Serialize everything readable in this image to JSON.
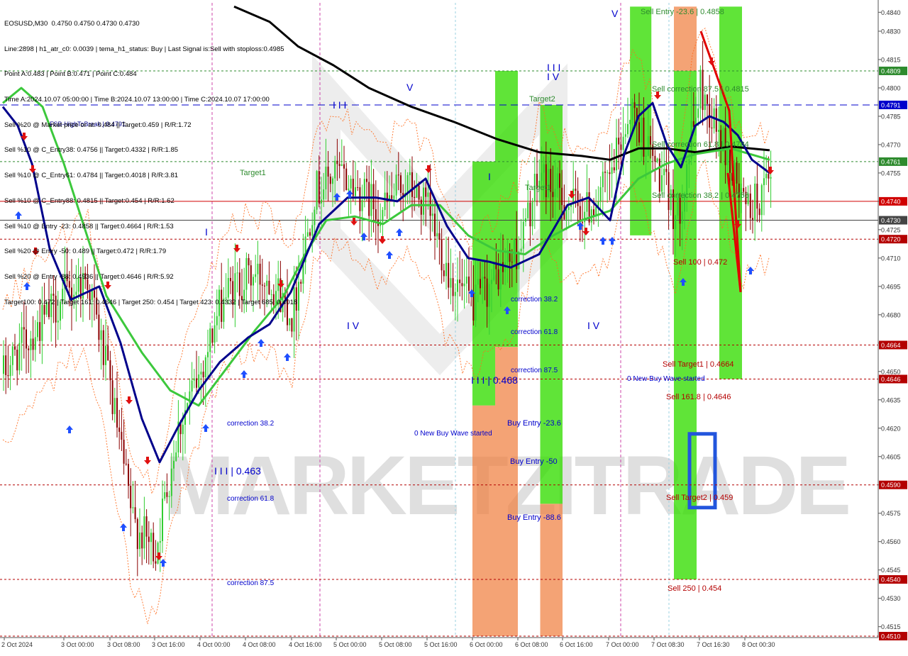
{
  "info": {
    "lines": [
      "EOSUSD,M30  0.4750 0.4750 0.4730 0.4730",
      "Line:2898 | h1_atr_c0: 0.0039 | tema_h1_status: Buy | Last Signal is:Sell with stoploss:0.4985",
      "Point A:0.483 | Point B:0.471 | Point C:0.484",
      "Time A:2024.10.07 05:00:00 | Time B:2024.10.07 13:00:00 | Time C:2024.10.07 17:00:00",
      "Sell %20 @ Market price or at: 0.484 || Target:0.459 | R/R:1.72",
      "Sell %10 @ C_Entry38: 0.4756 || Target:0.4332 | R/R:1.85",
      "Sell %10 @ C_Entry61: 0.4784 || Target:0.4018 | R/R:3.81",
      "Sell %10 @ C_Entry88: 0.4815 || Target:0.454 | R/R:1.62",
      "Sell %10 @ Entry -23: 0.4858 || Target:0.4664 | R/R:1.53",
      "Sell %20 @ Entry -50: 0.489 || Target:0.472 | R/R:1.79",
      "Sell %20 @ Entry -88: 0.4936 || Target:0.4646 | R/R:5.92",
      "Target100: 0.472 | Target 161: 0.4646 | Target 250: 0.454 | Target 423: 0.4332 | Target 685: 0.4018"
    ]
  },
  "colors": {
    "background": "#ffffff",
    "grid": "#c8c8c8",
    "bull": "#32cd32",
    "bear": "#8b0000",
    "ma_black": "#000000",
    "ma_blue": "#00008b",
    "ma_green": "#3cc83c",
    "dotted_orange": "#ff6a1a",
    "zone_green": "#33dd00",
    "zone_orange": "#f08040",
    "price_red": "#d00000",
    "label_blue": "#0000cc",
    "label_red": "#b40000",
    "label_green": "#2e8b2e"
  },
  "chart_data": {
    "type": "candlestick",
    "symbol": "EOSUSD",
    "timeframe": "M30",
    "ylim": [
      0.451,
      0.4845
    ],
    "y_ticks": [
      0.484,
      0.483,
      0.4815,
      0.48,
      0.4785,
      0.477,
      0.4755,
      0.474,
      0.4725,
      0.471,
      0.4695,
      0.468,
      0.4665,
      0.465,
      0.4635,
      0.462,
      0.4605,
      0.459,
      0.4575,
      0.456,
      0.4545,
      0.453,
      0.4515
    ],
    "y_tick_labels": [
      "0.4840",
      "0.4830",
      "0.4815",
      "0.4800",
      "0.4785",
      "0.4770",
      "0.4755",
      "0.4740",
      "0.4725",
      "0.4710",
      "0.4695",
      "0.4680",
      "0.4665",
      "0.4650",
      "0.4635",
      "0.4620",
      "0.4605",
      "0.4590",
      "0.4575",
      "0.4560",
      "0.4545",
      "0.4530",
      "0.4515"
    ],
    "x_ticks": [
      "2 Oct 2024",
      "3 Oct 00:00",
      "3 Oct 08:00",
      "3 Oct 16:00",
      "4 Oct 00:00",
      "4 Oct 08:00",
      "4 Oct 16:00",
      "5 Oct 00:00",
      "5 Oct 08:00",
      "5 Oct 16:00",
      "6 Oct 00:00",
      "6 Oct 08:00",
      "6 Oct 16:00",
      "7 Oct 00:00",
      "7 Oct 08:30",
      "7 Oct 16:30",
      "8 Oct 00:30"
    ],
    "price_levels": [
      {
        "label": "0.4809",
        "value": 0.4809,
        "color": "#2e8b2e",
        "style": "dotted"
      },
      {
        "label": "0.4791",
        "value": 0.4791,
        "color": "#0000cc",
        "style": "dashed"
      },
      {
        "label": "0.4761",
        "value": 0.4761,
        "color": "#2e8b2e",
        "style": "dotted"
      },
      {
        "label": "0.4740",
        "value": 0.474,
        "color": "#d00000",
        "style": "solid"
      },
      {
        "label": "0.4730",
        "value": 0.473,
        "color": "#444444",
        "style": "solid"
      },
      {
        "label": "0.4720",
        "value": 0.472,
        "color": "#b40000",
        "style": "dotted"
      },
      {
        "label": "0.4664",
        "value": 0.4664,
        "color": "#b40000",
        "style": "dotted"
      },
      {
        "label": "0.4646",
        "value": 0.4646,
        "color": "#b40000",
        "style": "dotted"
      },
      {
        "label": "0.4590",
        "value": 0.459,
        "color": "#b40000",
        "style": "dotted"
      },
      {
        "label": "0.4540",
        "value": 0.454,
        "color": "#b40000",
        "style": "dotted"
      },
      {
        "label": "0.4510",
        "value": 0.451,
        "color": "#b40000",
        "style": "dotted"
      }
    ],
    "zones": [
      {
        "color": "green",
        "x_from": "6 Oct 00:00",
        "x_to": "6 Oct 04:00",
        "y_from": 0.4761,
        "y_to": 0.4632
      },
      {
        "color": "orange",
        "x_from": "6 Oct 00:00",
        "x_to": "6 Oct 04:00",
        "y_from": 0.4632,
        "y_to": 0.451
      },
      {
        "color": "green",
        "x_from": "6 Oct 04:00",
        "x_to": "6 Oct 08:00",
        "y_from": 0.4809,
        "y_to": 0.4663
      },
      {
        "color": "orange",
        "x_from": "6 Oct 04:00",
        "x_to": "6 Oct 08:00",
        "y_from": 0.4663,
        "y_to": 0.451
      },
      {
        "color": "green",
        "x_from": "6 Oct 12:00",
        "x_to": "6 Oct 16:00",
        "y_from": 0.4791,
        "y_to": 0.458
      },
      {
        "color": "orange",
        "x_from": "6 Oct 12:00",
        "x_to": "6 Oct 16:00",
        "y_from": 0.458,
        "y_to": 0.451
      },
      {
        "color": "green",
        "x_from": "7 Oct 04:00",
        "x_to": "7 Oct 08:00",
        "y_from": 0.4843,
        "y_to": 0.4722
      },
      {
        "color": "orange",
        "x_from": "7 Oct 12:00",
        "x_to": "7 Oct 16:00",
        "y_from": 0.4843,
        "y_to": 0.4809
      },
      {
        "color": "green",
        "x_from": "7 Oct 12:00",
        "x_to": "7 Oct 16:00",
        "y_from": 0.4809,
        "y_to": 0.454
      },
      {
        "color": "green",
        "x_from": "7 Oct 20:00",
        "x_to": "8 Oct 00:00",
        "y_from": 0.4843,
        "y_to": 0.4646
      }
    ],
    "annotations": [
      {
        "text": "Sell Entry -23.6 | 0.4858",
        "color": "#2e8b2e"
      },
      {
        "text": "Sell correction 87.5 | 0.4815",
        "color": "#2e8b2e"
      },
      {
        "text": "Sell correction 61.8 | 0.4784",
        "color": "#2e8b2e"
      },
      {
        "text": "Sell correction 38.2 | 0.4756",
        "color": "#2e8b2e"
      },
      {
        "text": "Sell 100 | 0.472",
        "color": "#b40000"
      },
      {
        "text": "Sell Target1 | 0.4664",
        "color": "#b40000"
      },
      {
        "text": "Sell 161.8 | 0.4646",
        "color": "#b40000"
      },
      {
        "text": "Sell Target2 | 0.459",
        "color": "#b40000"
      },
      {
        "text": "Sell  250 | 0.454",
        "color": "#b40000"
      },
      {
        "text": "FSB-HighToBreak | 0.4791",
        "color": "#00008b"
      },
      {
        "text": "Target1",
        "color": "#2e8b2e"
      },
      {
        "text": "Target2",
        "color": "#2e8b2e"
      },
      {
        "text": "Target1",
        "color": "#2e8b2e"
      },
      {
        "text": "correction 38.2",
        "color": "#0000cc"
      },
      {
        "text": "correction 61.8",
        "color": "#0000cc"
      },
      {
        "text": "correction 87.5",
        "color": "#0000cc"
      },
      {
        "text": "I I I | 0.463",
        "color": "#0000cc"
      },
      {
        "text": "0 New Buy Wave started",
        "color": "#0000cc"
      },
      {
        "text": "correction 38.2",
        "color": "#0000cc"
      },
      {
        "text": "correction 61.8",
        "color": "#0000cc"
      },
      {
        "text": "correction 87.5",
        "color": "#0000cc"
      },
      {
        "text": "I I I | 0.468",
        "color": "#0000cc"
      },
      {
        "text": "Buy Entry -23.6",
        "color": "#0000cc"
      },
      {
        "text": "Buy Entry -50",
        "color": "#0000cc"
      },
      {
        "text": "Buy Entry -88.6",
        "color": "#0000cc"
      },
      {
        "text": "0 New Buy Wave started",
        "color": "#0000cc"
      },
      {
        "text": "I V",
        "color": "#0000cc"
      },
      {
        "text": "I V",
        "color": "#0000cc"
      },
      {
        "text": "V",
        "color": "#0000cc"
      },
      {
        "text": "V",
        "color": "#0000cc"
      },
      {
        "text": "I I I",
        "color": "#0000cc"
      },
      {
        "text": "I I I",
        "color": "#0000cc"
      },
      {
        "text": "I",
        "color": "#0000cc"
      },
      {
        "text": "I",
        "color": "#0000cc"
      },
      {
        "text": "I V",
        "color": "#0000cc"
      }
    ],
    "watermark": "MARKETZITRADE"
  }
}
